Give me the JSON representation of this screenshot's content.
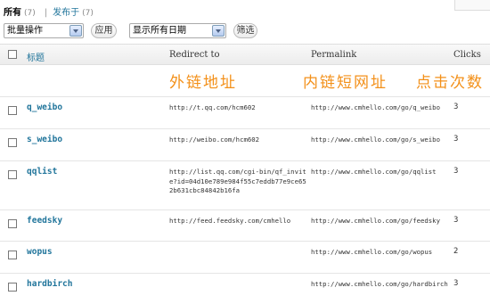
{
  "filters": {
    "all_label": "所有",
    "all_count": "(7)",
    "separator": "|",
    "published_label": "发布于",
    "published_count": "(7)"
  },
  "toolbar": {
    "bulk_actions": "批量操作",
    "apply_button": "应用",
    "date_filter": "显示所有日期",
    "filter_button": "筛选"
  },
  "table": {
    "headers": {
      "title": "标题",
      "redirect": "Redirect to",
      "permalink": "Permalink",
      "clicks": "Clicks"
    },
    "annotations": {
      "redirect": "外链地址",
      "permalink": "内链短网址",
      "clicks": "点击次数"
    },
    "rows": [
      {
        "title": "q_weibo",
        "redirect": "http://t.qq.com/hcm602",
        "permalink": "http://www.cmhello.com/go/q_weibo",
        "clicks": "3"
      },
      {
        "title": "s_weibo",
        "redirect": "http://weibo.com/hcm602",
        "permalink": "http://www.cmhello.com/go/s_weibo",
        "clicks": "3"
      },
      {
        "title": "qqlist",
        "redirect": "http://list.qq.com/cgi-bin/qf_invite?id=04d10e789e984f55c7eddb77e9ce652b631cbc84842b16fa",
        "permalink": "http://www.cmhello.com/go/qqlist",
        "clicks": "3"
      },
      {
        "title": "feedsky",
        "redirect": "http://feed.feedsky.com/cmhello",
        "permalink": "http://www.cmhello.com/go/feedsky",
        "clicks": "3"
      },
      {
        "title": "wopus",
        "redirect": "",
        "permalink": "http://www.cmhello.com/go/wopus",
        "clicks": "2"
      },
      {
        "title": "hardbirch",
        "redirect": "",
        "permalink": "http://www.cmhello.com/go/hardbirch",
        "clicks": "3"
      }
    ]
  },
  "colors": {
    "link": "#21759b",
    "annotation": "#f39019",
    "header_bg": "#ececec"
  }
}
